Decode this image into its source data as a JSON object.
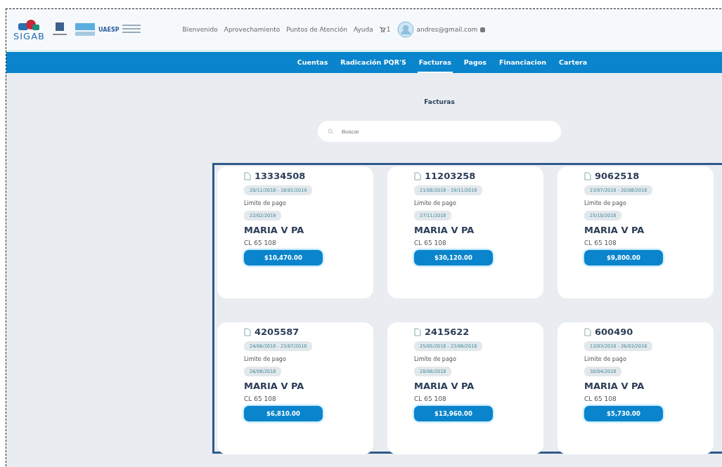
{
  "header": {
    "logo_text": "SIGAB",
    "partner_logo_text": "UAESP",
    "links": [
      "Bienvenido",
      "Aprovechamiento",
      "Puntos de Atención",
      "Ayuda"
    ],
    "cart_count": "1",
    "user_email": "andres@gmail.com"
  },
  "nav": [
    {
      "label": "Cuentas",
      "selected": false
    },
    {
      "label": "Radicación PQR'S",
      "selected": false
    },
    {
      "label": "Facturas",
      "selected": true
    },
    {
      "label": "Pagos",
      "selected": false
    },
    {
      "label": "Financiacion",
      "selected": false
    },
    {
      "label": "Cartera",
      "selected": false
    }
  ],
  "page_title": "Facturas",
  "search": {
    "placeholder": "Buscar"
  },
  "invoices": [
    {
      "number": "13334508",
      "period": "20/11/2018 - 18/01/2019",
      "due_label": "Limite de pago",
      "due_date": "22/02/2019",
      "name": "MARIA V PA",
      "address": "CL 65 108",
      "amount": "$10,470.00"
    },
    {
      "number": "11203258",
      "period": "21/08/2018 - 19/11/2018",
      "due_label": "Limite de pago",
      "due_date": "27/11/2018",
      "name": "MARIA V PA",
      "address": "CL 65 108",
      "amount": "$30,120.00"
    },
    {
      "number": "9062518",
      "period": "23/07/2018 - 20/08/2018",
      "due_label": "Limite de pago",
      "due_date": "25/10/2018",
      "name": "MARIA V PA",
      "address": "CL 65 108",
      "amount": "$9,800.00"
    },
    {
      "number": "4205587",
      "period": "24/06/2018 - 23/07/2018",
      "due_label": "Limite de pago",
      "due_date": "26/08/2018",
      "name": "MARIA V PA",
      "address": "CL 65 108",
      "amount": "$6,810.00"
    },
    {
      "number": "2415622",
      "period": "25/05/2018 - 23/06/2018",
      "due_label": "Limite de pago",
      "due_date": "28/06/2018",
      "name": "MARIA V PA",
      "address": "CL 65 108",
      "amount": "$13,960.00"
    },
    {
      "number": "600490",
      "period": "13/03/2018 - 26/03/2018",
      "due_label": "Limite de pago",
      "due_date": "30/04/2018",
      "name": "MARIA V PA",
      "address": "CL 65 108",
      "amount": "$5,730.00"
    }
  ]
}
